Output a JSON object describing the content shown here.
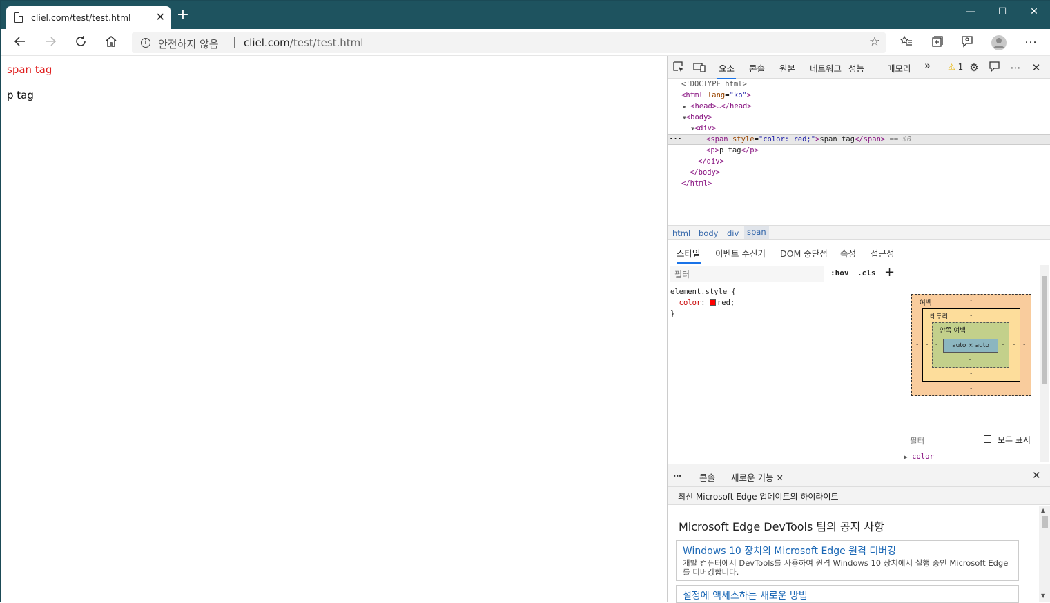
{
  "browser": {
    "tab_title": "cliel.com/test/test.html",
    "tab_close": "✕",
    "new_tab": "+",
    "window_controls": {
      "minimize": "—",
      "maximize": "☐",
      "close": "✕"
    },
    "security_label": "안전하지 않음",
    "url_host": "cliel.com",
    "url_path": "/test/test.html"
  },
  "page": {
    "span_text": "span tag",
    "p_text": "p tag",
    "span_color": "#e02020"
  },
  "devtools": {
    "tabs": [
      "요소",
      "콘솔",
      "원본",
      "네트워크",
      "성능",
      "메모리"
    ],
    "more_tabs": "»",
    "warning_count": "1",
    "dom_lines": {
      "doctype": "<!DOCTYPE html>",
      "html_open_tag": "<html",
      "html_lang_attr": "lang",
      "html_lang_val": "\"ko\"",
      "html_open_end": ">",
      "head": "<head>…</head>",
      "body_open": "<body>",
      "div_open": "<div>",
      "span_open": "<span",
      "span_style_attr": "style",
      "span_style_val": "\"color: red;\"",
      "span_gt": ">",
      "span_text": "span tag",
      "span_close": "</span>",
      "selected_marker": "== $0",
      "p_open": "<p>",
      "p_text": "p tag",
      "p_close": "</p>",
      "div_close": "</div>",
      "body_close": "</body>",
      "html_close": "</html>",
      "dots": "···"
    },
    "breadcrumbs": [
      "html",
      "body",
      "div",
      "span"
    ],
    "subtabs": [
      "스타일",
      "이벤트 수신기",
      "DOM 중단점",
      "속성",
      "접근성"
    ],
    "styles": {
      "filter_placeholder": "필터",
      "hov": ":hov",
      "cls": ".cls",
      "add": "+",
      "selector": "element.style {",
      "property": "color",
      "value": "red;",
      "close": "}"
    },
    "box_model": {
      "margin_label": "여백",
      "border_label": "테두리",
      "padding_label": "안쪽 여백",
      "content": "auto × auto",
      "dash": "-"
    },
    "computed": {
      "filter": "필터",
      "show_all": "모두 표시",
      "first_property": "color"
    },
    "drawer": {
      "tabs": [
        "콘솔",
        "새로운 기능"
      ],
      "close": "✕"
    },
    "whats_new": {
      "header": "최신 Microsoft Edge 업데이트의 하이라이트",
      "title": "Microsoft Edge DevTools 팀의 공지 사항",
      "cards": [
        {
          "title": "Windows 10 장치의 Microsoft Edge 원격 디버깅",
          "desc": "개발 컴퓨터에서 DevTools를 사용하여 원격 Windows 10 장치에서 실행 중인 Microsoft Edge를 디버깅합니다."
        },
        {
          "title": "설정에 액세스하는 새로운 방법",
          "desc": ""
        }
      ]
    }
  }
}
